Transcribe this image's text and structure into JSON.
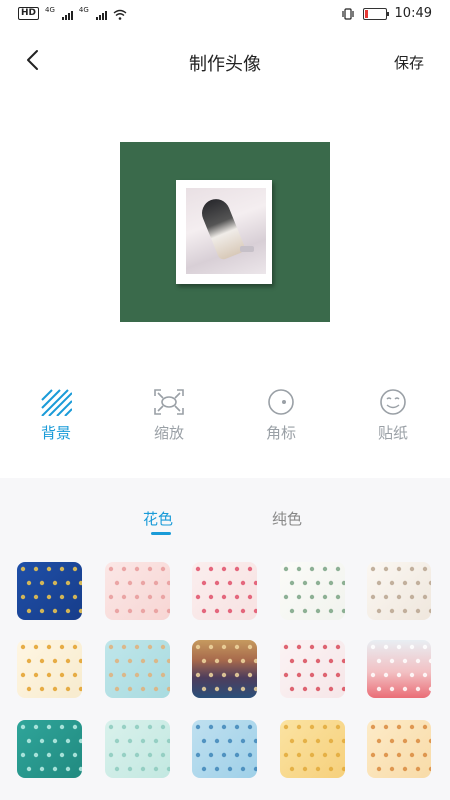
{
  "status_bar": {
    "hd": "HD",
    "net1": "4G",
    "net2": "4G",
    "time": "10:49",
    "battery_level": 0.15,
    "battery_color": "#e53935"
  },
  "header": {
    "title": "制作头像",
    "save_label": "保存",
    "back_icon": "chevron-left-icon"
  },
  "tools": [
    {
      "label": "背景",
      "icon": "diagonal-stripes-icon",
      "active": true
    },
    {
      "label": "缩放",
      "icon": "scale-frame-icon",
      "active": false
    },
    {
      "label": "角标",
      "icon": "badge-circle-icon",
      "active": false
    },
    {
      "label": "贴纸",
      "icon": "smiley-icon",
      "active": false
    }
  ],
  "tabs": [
    {
      "label": "花色",
      "active": true
    },
    {
      "label": "纯色",
      "active": false
    }
  ],
  "colors": {
    "accent": "#1a9bd8",
    "canvas_bg": "#3a6a4b",
    "inactive": "#9aa0a6"
  },
  "patterns": [
    {
      "name": "blue-stars-pattern",
      "bg": "linear-gradient(135deg,#1f4fa8,#173d8a)",
      "dots": "#f2c94c"
    },
    {
      "name": "pink-pigs-pattern",
      "bg": "linear-gradient(135deg,#fbe7e6,#f7d6d4)",
      "dots": "#e89a9a"
    },
    {
      "name": "watermelon-pattern",
      "bg": "linear-gradient(135deg,#fbeeee,#f7e2e2)",
      "dots": "#e0506a"
    },
    {
      "name": "leaves-pattern",
      "bg": "linear-gradient(135deg,#fbfbf8,#f1f3ee)",
      "dots": "#7aa384"
    },
    {
      "name": "cats-sketch-pattern",
      "bg": "linear-gradient(135deg,#fbf7f2,#efe7dd)",
      "dots": "#b9a58f"
    },
    {
      "name": "pineapple-pattern",
      "bg": "linear-gradient(135deg,#fff6e3,#f7ebce)",
      "dots": "#e3a02a"
    },
    {
      "name": "shiba-blue-pattern",
      "bg": "linear-gradient(135deg,#bfe6ea,#a9dbe0)",
      "dots": "#e0b07a"
    },
    {
      "name": "scales-gradient-pattern",
      "bg": "linear-gradient(180deg,#c69a5f 0%,#a7694c 35%,#4e3d5c 65%,#2a4f7a 100%)",
      "dots": "#f0d7a0"
    },
    {
      "name": "strawberry-pattern",
      "bg": "linear-gradient(135deg,#fbf3f4,#f6e6e8)",
      "dots": "#d94b5a"
    },
    {
      "name": "pink-gradient-pattern",
      "bg": "linear-gradient(180deg,#e8eef3 0%,#f2c1c4 55%,#ea6d76 100%)",
      "dots": "#ffffff"
    },
    {
      "name": "teal-dots-pattern",
      "bg": "linear-gradient(135deg,#2fa59a,#218a80)",
      "dots": "#bdeee6"
    },
    {
      "name": "mint-wave-pattern",
      "bg": "linear-gradient(135deg,#d9f1ec,#c3e8e1)",
      "dots": "#8ccabd"
    },
    {
      "name": "blue-leaves-pattern",
      "bg": "linear-gradient(135deg,#bfe0f0,#9fd0e8)",
      "dots": "#3f86b8"
    },
    {
      "name": "yellow-leaves-pattern",
      "bg": "linear-gradient(135deg,#fbe3a2,#f6d07c)",
      "dots": "#e2a93a"
    },
    {
      "name": "shiba-orange-pattern",
      "bg": "linear-gradient(135deg,#fdebc8,#f8dba8)",
      "dots": "#d98a3e"
    }
  ]
}
